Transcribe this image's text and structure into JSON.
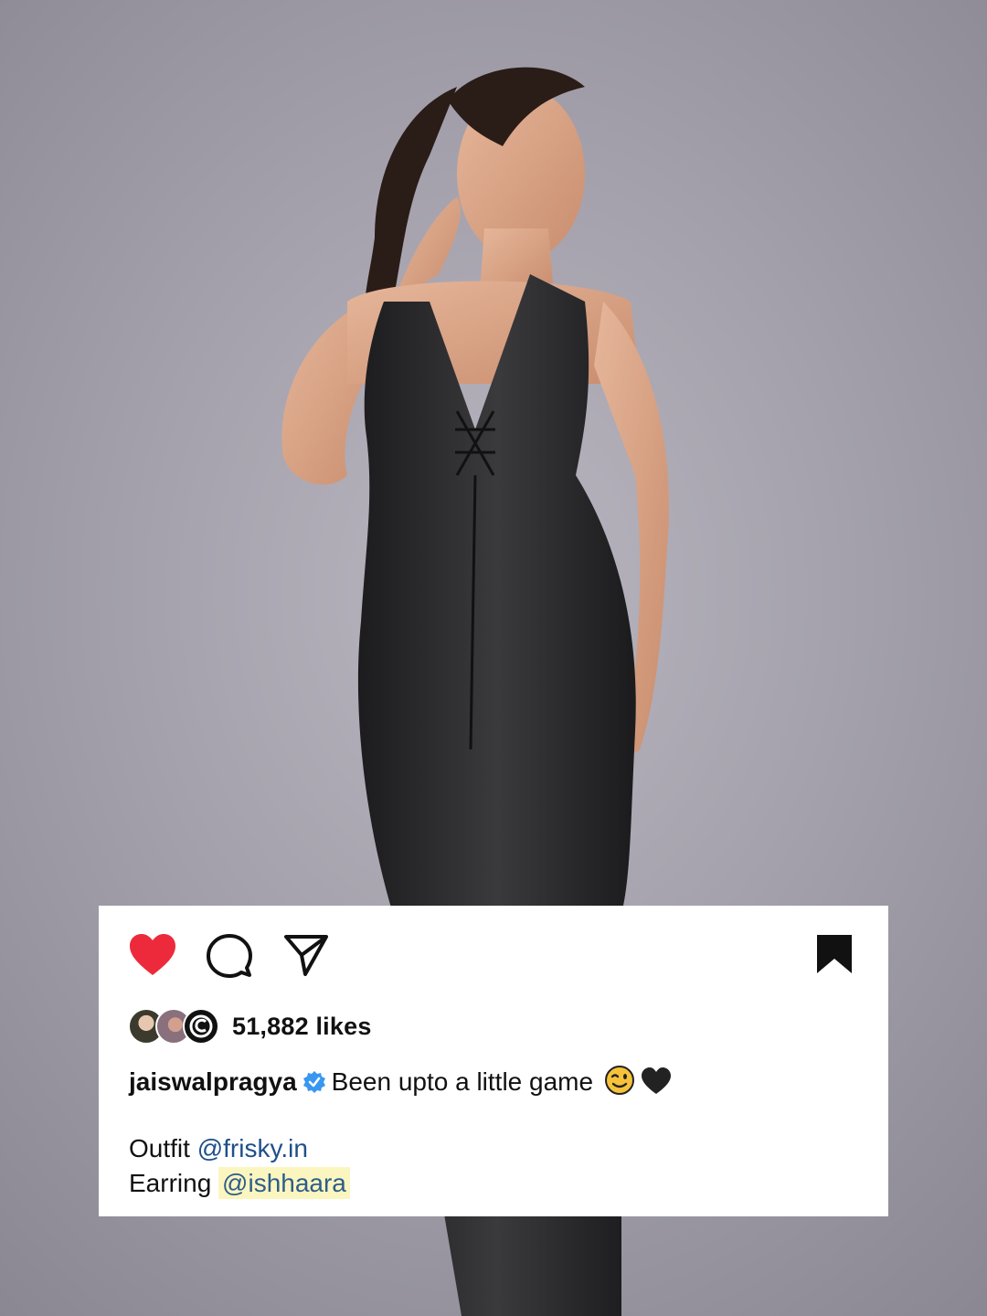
{
  "photo": {
    "subject": "woman in black lace-up halter midi dress posing against grey backdrop"
  },
  "post": {
    "actions": {
      "like_icon": "heart-filled-icon",
      "comment_icon": "comment-icon",
      "share_icon": "send-icon",
      "save_icon": "bookmark-filled-icon",
      "like_color": "#ed2a3b"
    },
    "likes": "51,882 likes",
    "caption": {
      "username": "jaiswalpragya",
      "verified_color": "#3897f0",
      "text": "Been upto a little game",
      "emojis": [
        "wink-emoji",
        "black-heart-emoji"
      ],
      "outfit_label": "Outfit",
      "outfit_mention": "@frisky.in",
      "earring_label": "Earring",
      "earring_mention": "@ishhaara"
    }
  }
}
